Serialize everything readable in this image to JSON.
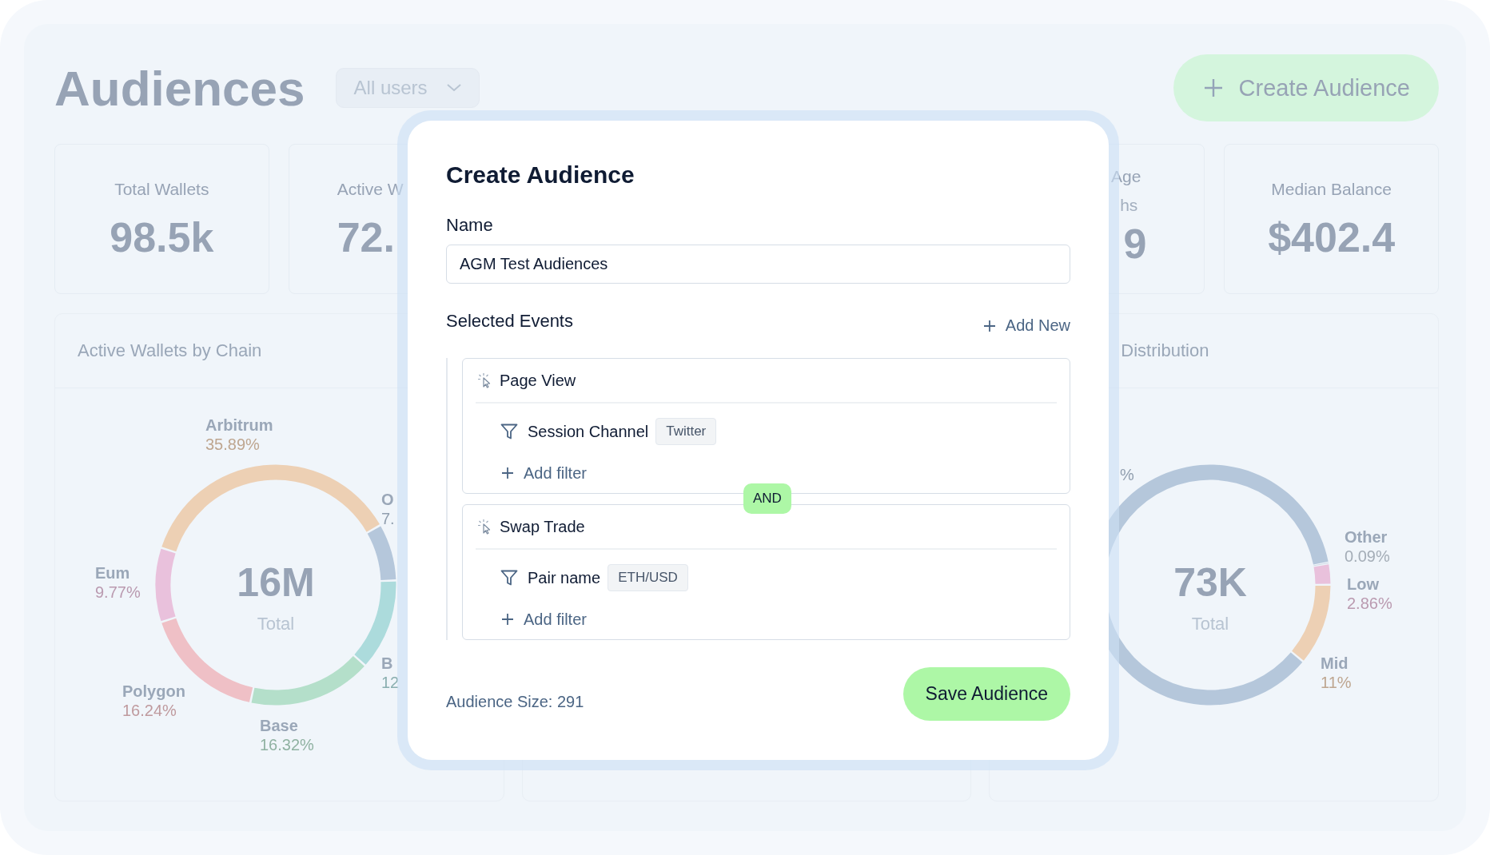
{
  "page": {
    "title": "Audiences",
    "filter": {
      "value": "All users"
    },
    "create_button": {
      "label": "Create Audience"
    }
  },
  "stat_cards": [
    {
      "label": "Total Wallets",
      "value": "98.5k"
    },
    {
      "label": "Active W",
      "value": "72."
    },
    {
      "label": "Age",
      "sublabel": "hs",
      "value": "9"
    },
    {
      "label": "Median Balance",
      "value": "$402.4"
    }
  ],
  "charts": [
    {
      "title": "Active Wallets by Chain",
      "center_value": "16M",
      "center_label": "Total",
      "chart_data": {
        "type": "donut",
        "categories": [
          "Arbitrum",
          "O",
          "B",
          "Base",
          "Polygon",
          "Eum"
        ],
        "values": [
          35.89,
          7.5,
          12,
          16.32,
          16.24,
          9.77
        ],
        "value_labels": [
          "35.89%",
          "7.",
          "12",
          "16.32%",
          "16.24%",
          "9.77%"
        ],
        "colors": [
          "#edd0b4",
          "#b5c7db",
          "#acdbdc",
          "#b4dfca",
          "#efc0c6",
          "#e9c1dc"
        ]
      }
    },
    {
      "title": "Distribution",
      "center_value": "73K",
      "center_label": "Total",
      "chart_data": {
        "type": "donut",
        "categories": [
          "Other",
          "Low",
          "Mid",
          null
        ],
        "values": [
          0.09,
          2.86,
          11,
          86.05
        ],
        "value_labels": [
          "0.09%",
          "2.86%",
          "11%",
          "%"
        ],
        "colors": [
          "#cdd8e5",
          "#e9c1dc",
          "#edd0b4",
          "#b5c7db"
        ]
      }
    }
  ],
  "dialog": {
    "title": "Create Audience",
    "name_label": "Name",
    "name_value": "AGM Test Audiences",
    "events_label": "Selected Events",
    "add_new": "Add New",
    "events": [
      {
        "name": "Page View",
        "filters": [
          {
            "field": "Session Channel",
            "value": "Twitter"
          }
        ],
        "add_filter": "Add filter",
        "joiner": "AND"
      },
      {
        "name": "Swap Trade",
        "filters": [
          {
            "field": "Pair name",
            "value": "ETH/USD"
          }
        ],
        "add_filter": "Add filter"
      }
    ],
    "size_text": "Audience Size: 291",
    "save_button": "Save Audience"
  }
}
